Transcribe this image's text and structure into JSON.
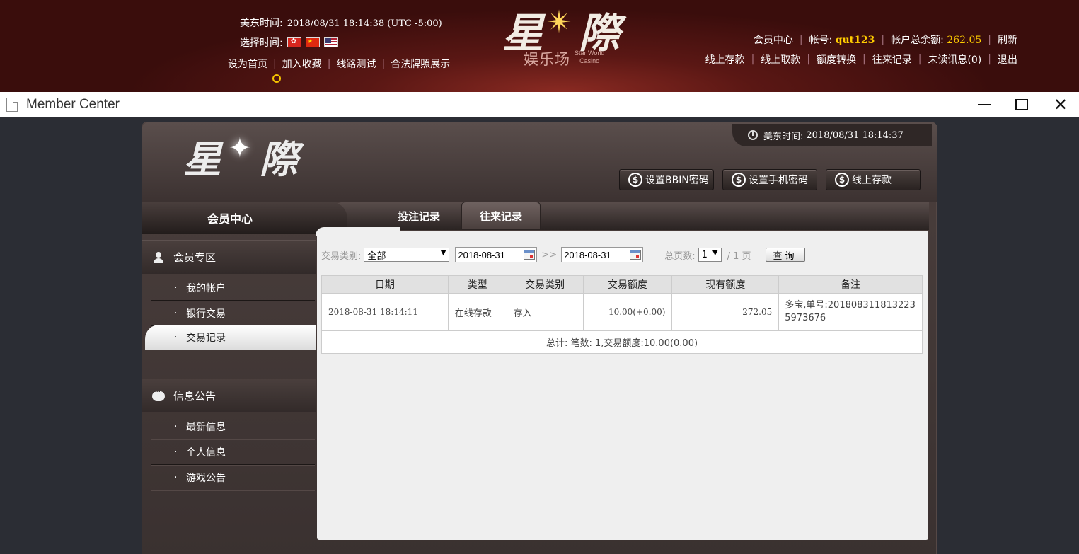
{
  "site_header": {
    "time_label": "美东时间:",
    "time_value": "2018/08/31 18:14:38 (UTC -5:00)",
    "lang_label": "选择时间:",
    "links": [
      "设为首页",
      "加入收藏",
      "线路测试",
      "合法牌照展示"
    ],
    "logo_char1": "星",
    "logo_char2": "際",
    "logo_cn": "娱乐场",
    "logo_en_line1": "Star World",
    "logo_en_line2": "Casino",
    "member_center": "会员中心",
    "account_label": "帐号:",
    "account_value": "qut123",
    "balance_label": "帐户总余额:",
    "balance_value": "262.05",
    "refresh": "刷新",
    "nav2": [
      "线上存款",
      "线上取款",
      "额度转换",
      "往来记录",
      "未读讯息(0)",
      "退出"
    ]
  },
  "window": {
    "title": "Member Center",
    "icon": "document-icon",
    "controls": [
      "minimize-icon",
      "maximize-icon",
      "close-icon"
    ]
  },
  "panel": {
    "logo_char1": "星",
    "logo_char2": "際",
    "clock_label": "美东时间:",
    "clock_value": "2018/08/31 18:14:37",
    "buttons": [
      "设置BBIN密码",
      "设置手机密码",
      "线上存款"
    ],
    "member_tab": "会员中心",
    "tabs": [
      "投注记录",
      "往来记录"
    ],
    "active_tab": "往来记录"
  },
  "sidebar": {
    "section1": "会员专区",
    "items1": [
      "我的帐户",
      "银行交易",
      "交易记录"
    ],
    "active_item": "交易记录",
    "section2": "信息公告",
    "items2": [
      "最新信息",
      "个人信息",
      "游戏公告"
    ]
  },
  "filters": {
    "type_label": "交易类别:",
    "type_value": "全部",
    "date_from": "2018-08-31",
    "sep": ">>",
    "date_to": "2018-08-31",
    "pages_label": "总页数:",
    "page_value": "1",
    "page_total": "/ 1 页",
    "query_button": "查询"
  },
  "table": {
    "headers": [
      "日期",
      "类型",
      "交易类别",
      "交易额度",
      "现有额度",
      "备注"
    ],
    "rows": [
      [
        "2018-08-31 18:14:11",
        "在线存款",
        "存入",
        "10.00(+0.00)",
        "272.05",
        "多宝,单号:20180831181322359736​76"
      ]
    ],
    "total": "总计: 笔数: 1,交易额度:10.00(0.00)"
  },
  "colors": {
    "accent_yellow": "#ffcc00",
    "header_red": "#5a1714",
    "panel_brown": "#3a3130"
  }
}
